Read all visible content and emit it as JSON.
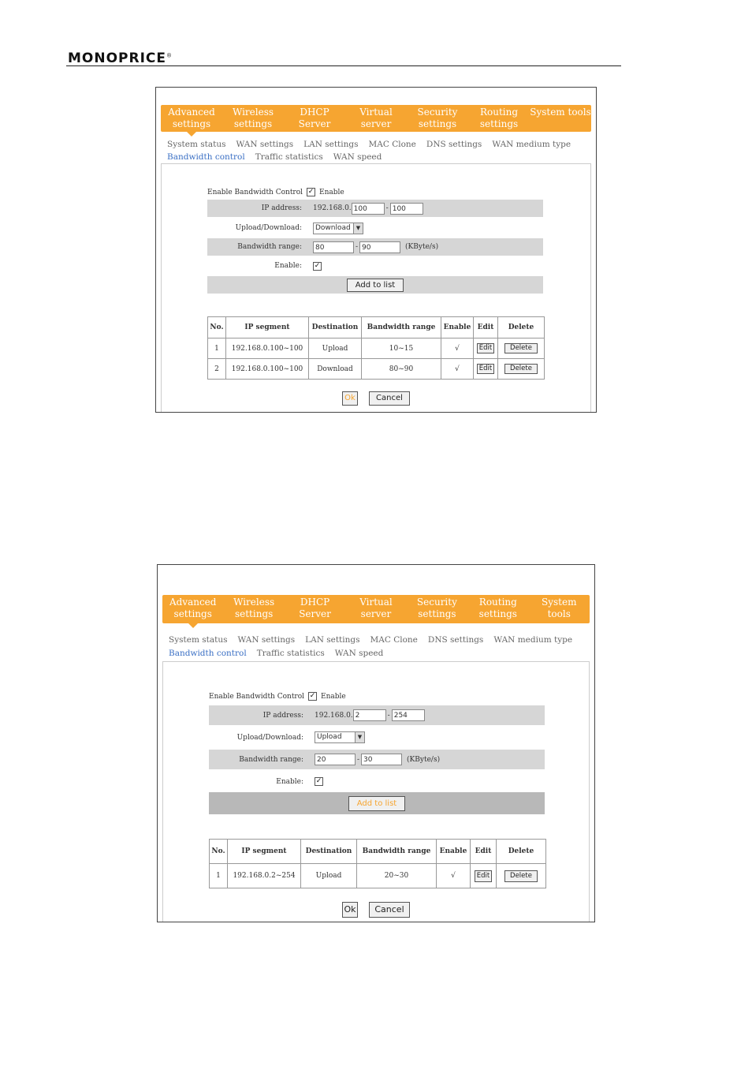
{
  "header": {
    "brand": "MONOPRICE",
    "registered": "®"
  },
  "nav": [
    "Advanced settings",
    "Wireless settings",
    "DHCP Server",
    "Virtual server",
    "Security settings",
    "Routing settings",
    "System tools"
  ],
  "subnav": [
    "System status",
    "WAN settings",
    "LAN settings",
    "MAC Clone",
    "DNS settings",
    "WAN medium type",
    "Bandwidth control",
    "Traffic statistics",
    "WAN speed"
  ],
  "labels": {
    "enable_bw": "Enable Bandwidth Control",
    "enable_word": "Enable",
    "ip_address": "IP address:",
    "ip_prefix": "192.168.0.",
    "upload_download": "Upload/Download:",
    "bandwidth_range": "Bandwidth range:",
    "range_sep": "-",
    "unit": "(KByte/s)",
    "enable_field": "Enable:",
    "add_to_list": "Add to list",
    "ok": "Ok",
    "cancel": "Cancel",
    "check": "✓"
  },
  "table_headers": [
    "No.",
    "IP segment",
    "Destination",
    "Bandwidth range",
    "Enable",
    "Edit",
    "Delete"
  ],
  "shot1": {
    "ip_start": "100",
    "ip_end": "100",
    "direction": "Download",
    "bw_min": "80",
    "bw_max": "90",
    "rows": [
      {
        "no": "1",
        "ip": "192.168.0.100~100",
        "dest": "Upload",
        "range": "10~15",
        "enable": "√",
        "edit": "Edit",
        "delete": "Delete"
      },
      {
        "no": "2",
        "ip": "192.168.0.100~100",
        "dest": "Download",
        "range": "80~90",
        "enable": "√",
        "edit": "Edit",
        "delete": "Delete"
      }
    ]
  },
  "shot2": {
    "ip_start": "2",
    "ip_end": "254",
    "direction": "Upload",
    "bw_min": "20",
    "bw_max": "30",
    "rows": [
      {
        "no": "1",
        "ip": "192.168.0.2~254",
        "dest": "Upload",
        "range": "20~30",
        "enable": "√",
        "edit": "Edit",
        "delete": "Delete"
      }
    ]
  }
}
